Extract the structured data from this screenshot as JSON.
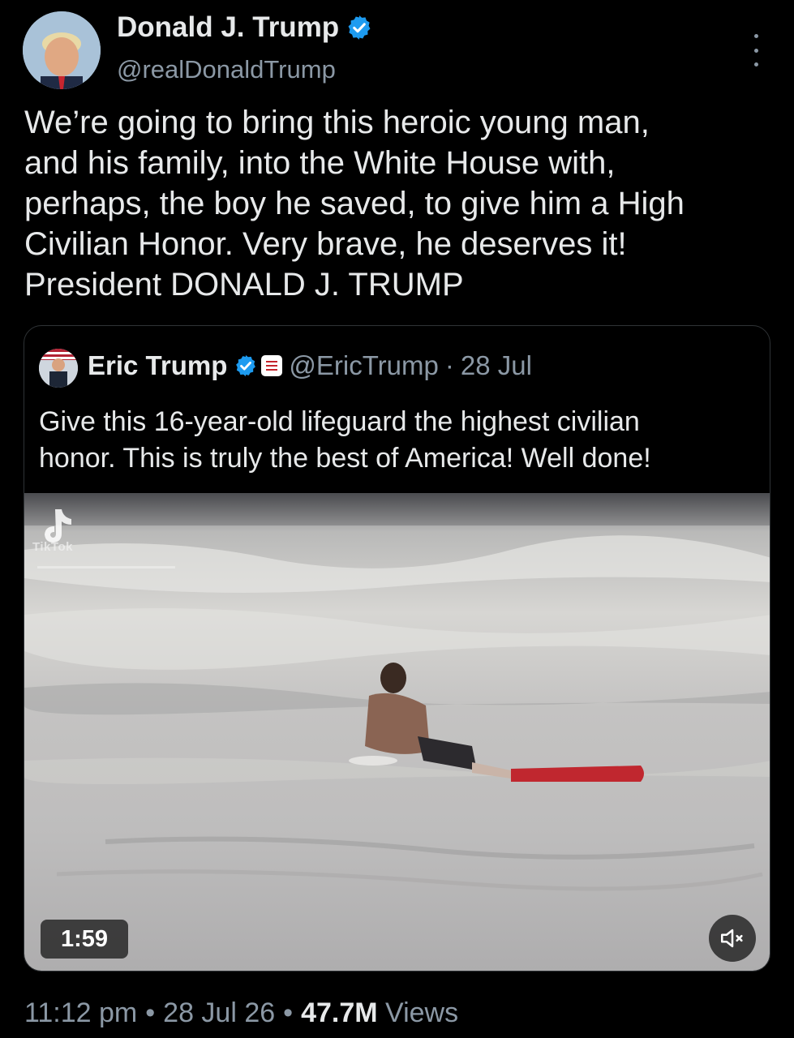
{
  "author": {
    "name": "Donald J. Trump",
    "handle": "@realDonaldTrump",
    "verified_icon": "verified-badge-icon",
    "accent_color": "#1d9bf0"
  },
  "tweet": {
    "text": "We’re going to bring this heroic young man,\nand his family, into the White House with,\nperhaps, the boy he saved, to give him a High\nCivilian Honor. Very brave, he deserves it!\nPresident DONALD J. TRUMP"
  },
  "quoted": {
    "name": "Eric Trump",
    "handle": "@EricTrump",
    "separator": "·",
    "date": "28 Jul",
    "text": "Give this 16-year-old lifeguard the highest civilian\nhonor.  This is truly the best of America! Well done!",
    "video": {
      "watermark": "TikTok",
      "duration": "1:59",
      "mute_icon": "speaker-muted-icon"
    }
  },
  "meta": {
    "time": "11:12 pm",
    "dot1": "•",
    "date": "28 Jul 26",
    "dot2": "•",
    "views_count": "47.7M",
    "views_label": "Views"
  }
}
